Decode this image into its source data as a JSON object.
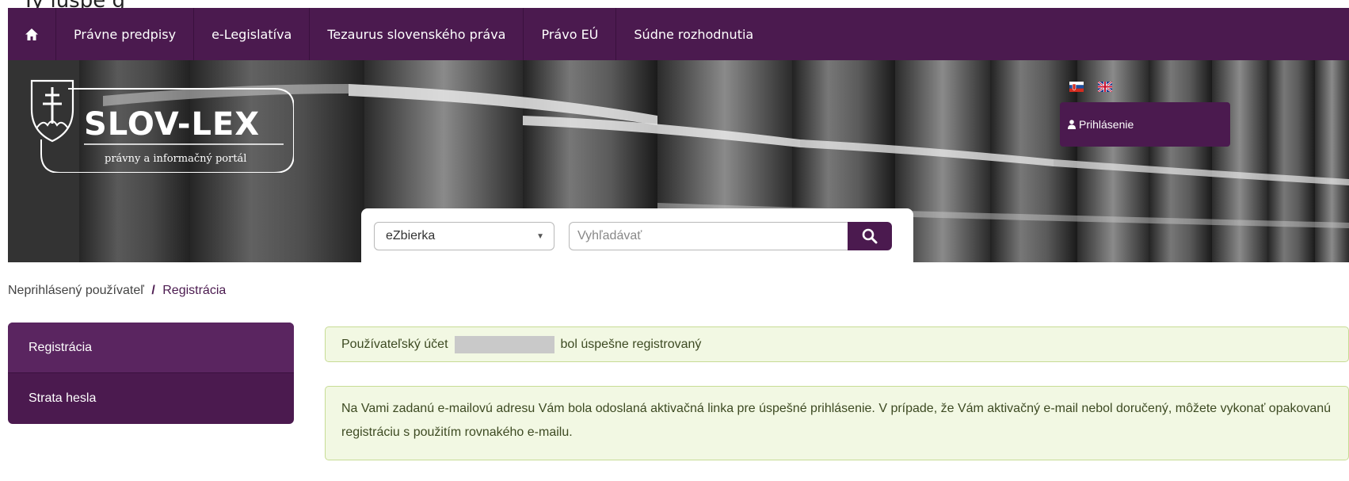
{
  "clipped_heading": "Ty    lúspe   g",
  "nav": {
    "items": [
      {
        "label": "Právne predpisy"
      },
      {
        "label": "e-Legislatíva"
      },
      {
        "label": "Tezaurus slovenského práva"
      },
      {
        "label": "Právo EÚ"
      },
      {
        "label": "Súdne rozhodnutia"
      }
    ]
  },
  "logo": {
    "wordmark": "SLOV-LEX",
    "tagline": "právny a informačný portál"
  },
  "header": {
    "login_label": "Prihlásenie"
  },
  "search": {
    "select_value": "eZbierka",
    "placeholder": "Vyhľadávať"
  },
  "breadcrumb": {
    "parent": "Neprihlásený používateľ",
    "separator": "/",
    "current": "Registrácia"
  },
  "sidebar": {
    "items": [
      {
        "label": "Registrácia"
      },
      {
        "label": "Strata hesla"
      }
    ]
  },
  "alerts": {
    "account_prefix": "Používateľský účet",
    "account_suffix": "bol úspešne registrovaný",
    "activation_message": "Na Vami zadanú e-mailovú adresu Vám bola odoslaná aktivačná linka pre úspešné prihlásenie. V prípade, že Vám aktivačný e-mail nebol doručený, môžete vykonať opakovanú registráciu s použitím rovnakého e-mailu."
  },
  "colors": {
    "brand": "#4b1a4f",
    "alert_bg": "#f2f8e3",
    "alert_border": "#c7dc95"
  }
}
